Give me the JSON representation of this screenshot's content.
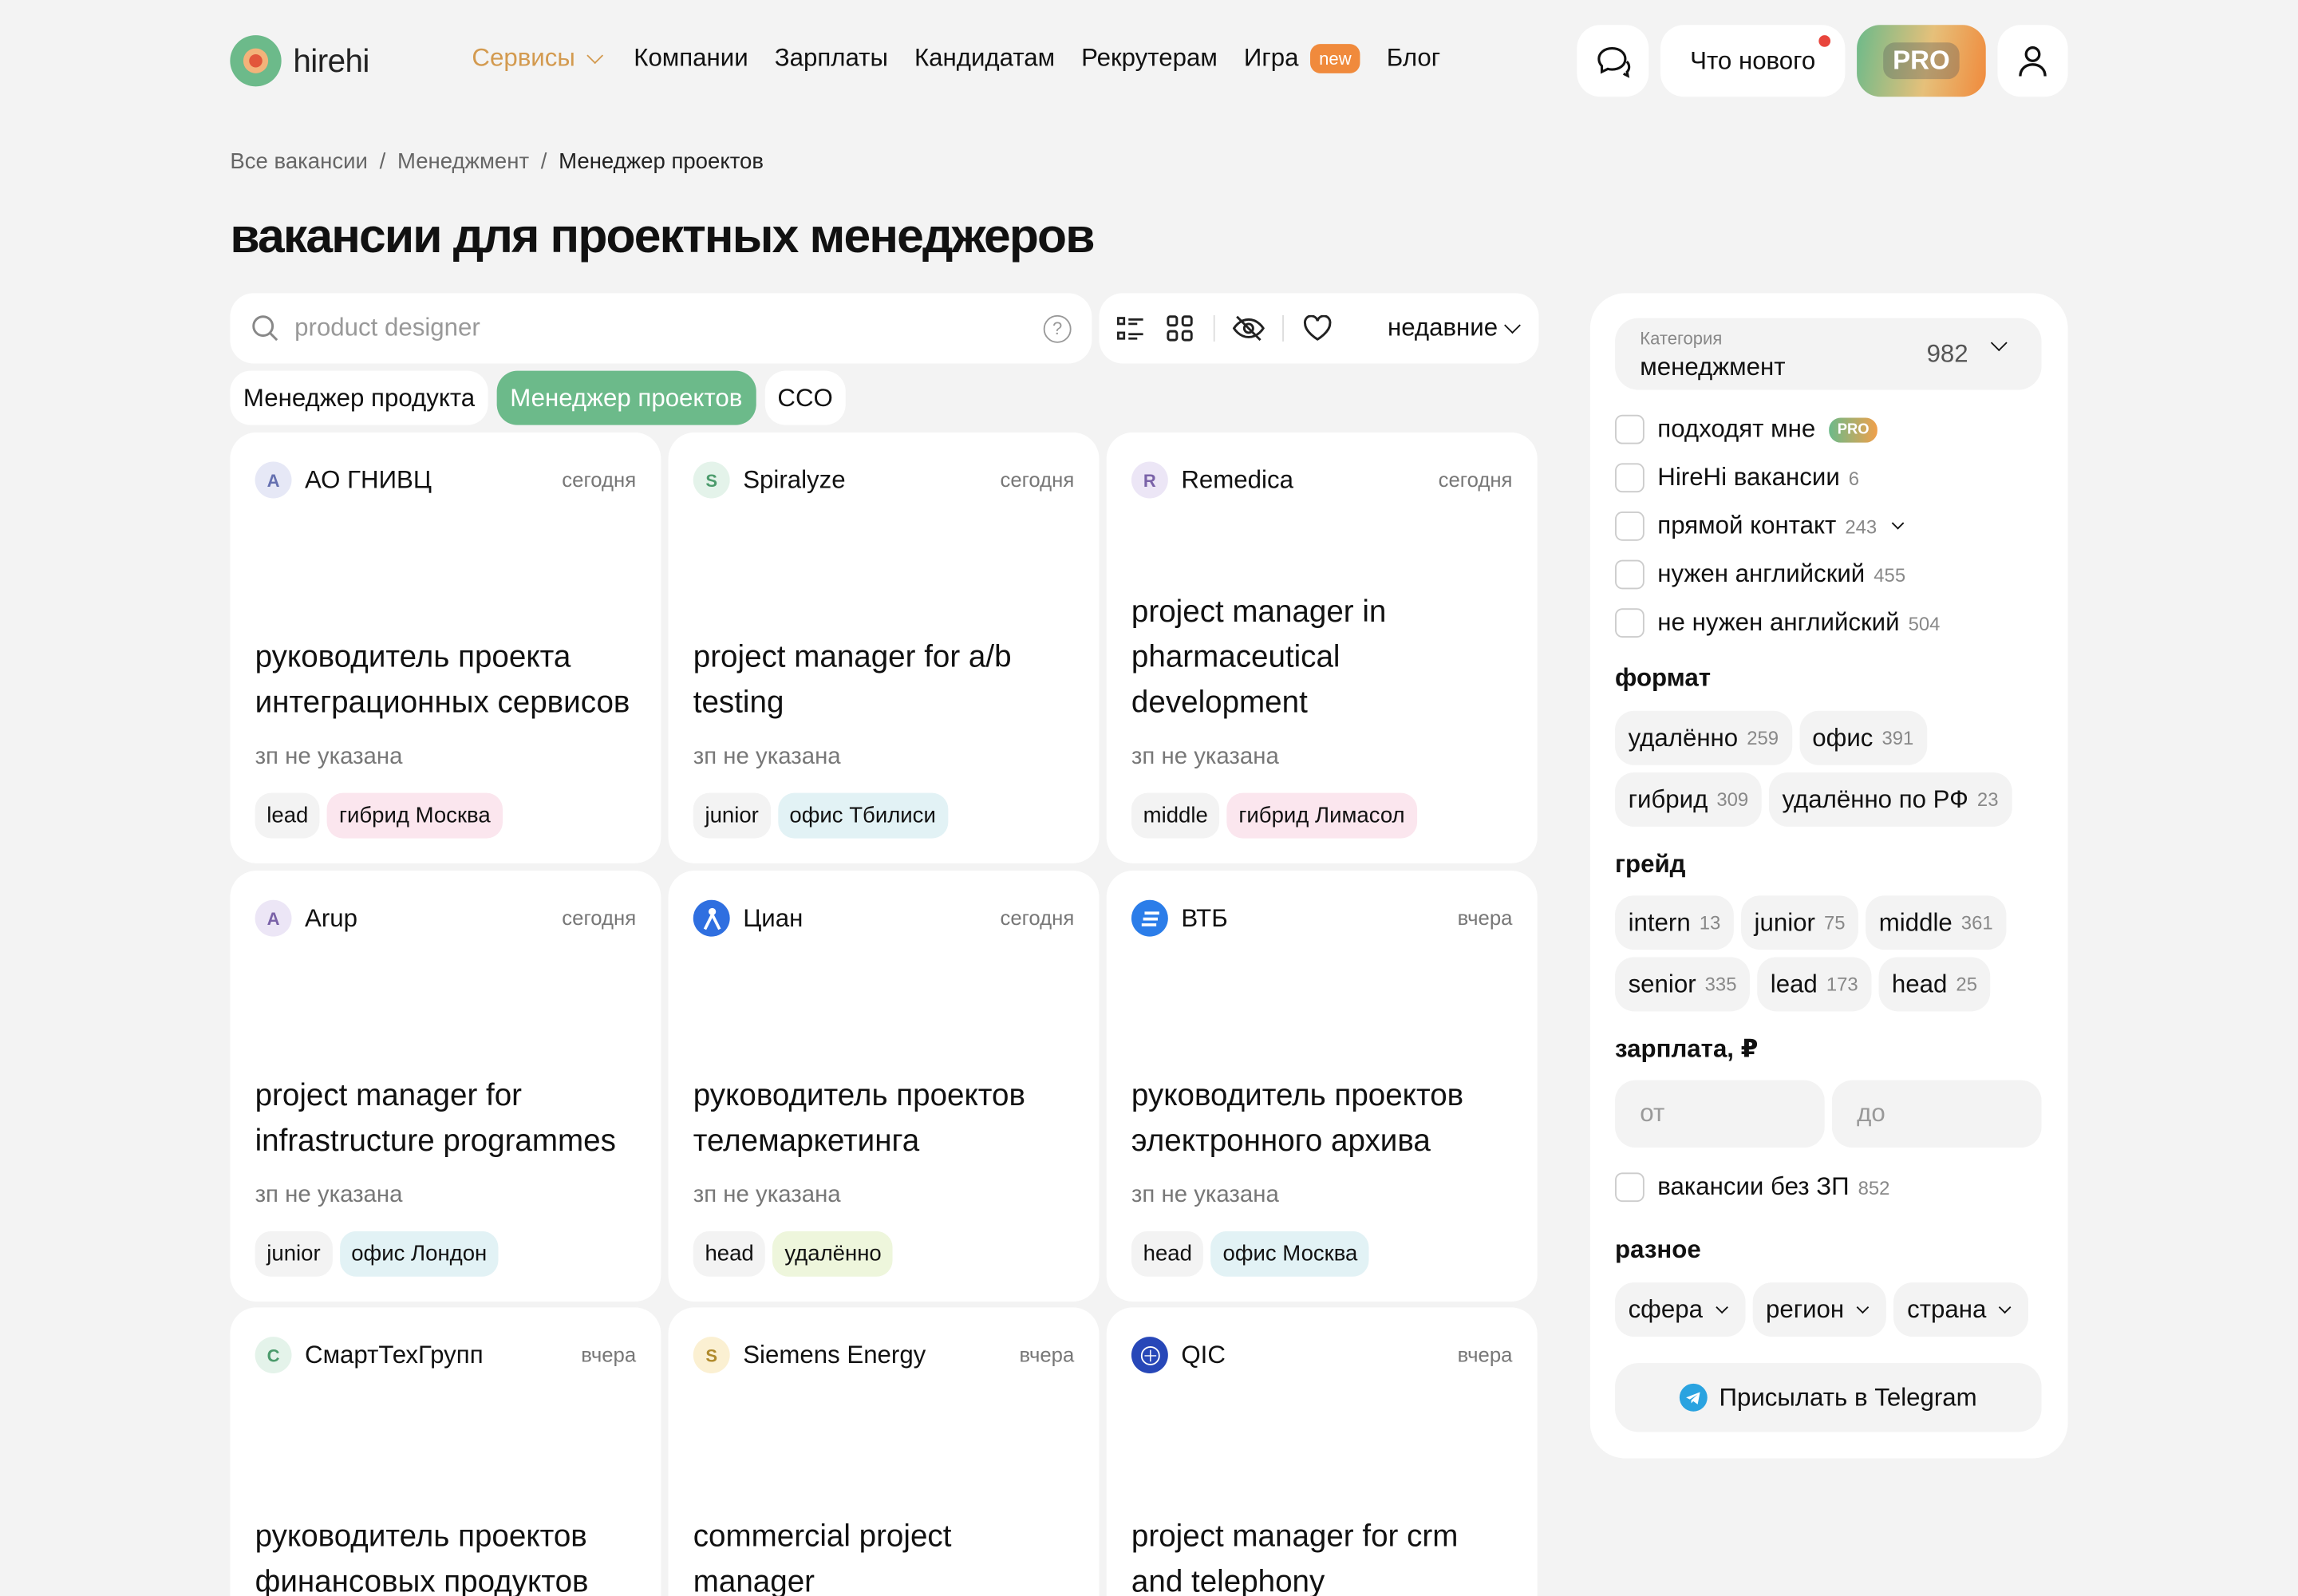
{
  "header": {
    "logo": "hirehi",
    "nav": {
      "services": "Сервисы",
      "companies": "Компании",
      "salaries": "Зарплаты",
      "candidates": "Кандидатам",
      "recruiters": "Рекрутерам",
      "game": "Игра",
      "game_badge": "new",
      "blog": "Блог"
    },
    "whats_new": "Что нового",
    "pro": "PRO"
  },
  "breadcrumb": [
    "Все вакансии",
    "/",
    "Менеджмент",
    "/",
    "Менеджер проектов"
  ],
  "page_title": "вакансии для проектных менеджеров",
  "search": {
    "placeholder": "product designer",
    "help": "?"
  },
  "sort": "недавние",
  "chips": [
    "Менеджер продукта",
    "Менеджер проектов",
    "CCO"
  ],
  "cards": [
    {
      "company": "АО ГНИВЦ",
      "initial": "A",
      "date": "сегодня",
      "title": "руководитель проекта интеграционных сервисов",
      "salary": "зп не указана",
      "tags": [
        "lead",
        "гибрид Москва"
      ]
    },
    {
      "company": "Spiralyze",
      "initial": "S",
      "date": "сегодня",
      "title": "project manager for a/b testing",
      "salary": "зп не указана",
      "tags": [
        "junior",
        "офис Тбилиси"
      ]
    },
    {
      "company": "Remedica",
      "initial": "R",
      "date": "сегодня",
      "title": "project manager in pharmaceutical development",
      "salary": "зп не указана",
      "tags": [
        "middle",
        "гибрид Лимасол"
      ]
    },
    {
      "company": "Arup",
      "initial": "A",
      "date": "сегодня",
      "title": "project manager for infrastructure programmes",
      "salary": "зп не указана",
      "tags": [
        "junior",
        "офис Лондон"
      ]
    },
    {
      "company": "Циан",
      "initial": "",
      "date": "сегодня",
      "title": "руководитель проектов телемаркетинга",
      "salary": "зп не указана",
      "tags": [
        "head",
        "удалённо"
      ]
    },
    {
      "company": "ВТБ",
      "initial": "",
      "date": "вчера",
      "title": "руководитель проектов электронного архива",
      "salary": "зп не указана",
      "tags": [
        "head",
        "офис Москва"
      ]
    },
    {
      "company": "СмартТехГрупп",
      "initial": "C",
      "date": "вчера",
      "title": "руководитель проектов финансовых продуктов",
      "salary": "",
      "tags": []
    },
    {
      "company": "Siemens Energy",
      "initial": "S",
      "date": "вчера",
      "title": "commercial project manager",
      "salary": "",
      "tags": []
    },
    {
      "company": "QIC",
      "initial": "",
      "date": "вчера",
      "title": "project manager for crm and telephony",
      "salary": "",
      "tags": []
    }
  ],
  "filters": {
    "category_label": "Категория",
    "category_value": "менеджмент",
    "category_count": "982",
    "checks": [
      {
        "label": "подходят мне",
        "count": "",
        "badge": "PRO"
      },
      {
        "label": "HireHi вакансии",
        "count": "6"
      },
      {
        "label": "прямой контакт",
        "count": "243"
      },
      {
        "label": "нужен английский",
        "count": "455"
      },
      {
        "label": "не нужен английский",
        "count": "504"
      }
    ],
    "format_title": "формат",
    "format": [
      {
        "label": "удалённо",
        "count": "259"
      },
      {
        "label": "офис",
        "count": "391"
      },
      {
        "label": "гибрид",
        "count": "309"
      },
      {
        "label": "удалённо по РФ",
        "count": "23"
      }
    ],
    "grade_title": "грейд",
    "grade": [
      {
        "label": "intern",
        "count": "13"
      },
      {
        "label": "junior",
        "count": "75"
      },
      {
        "label": "middle",
        "count": "361"
      },
      {
        "label": "senior",
        "count": "335"
      },
      {
        "label": "lead",
        "count": "173"
      },
      {
        "label": "head",
        "count": "25"
      }
    ],
    "salary_title": "зарплата, ₽",
    "salary_from": "от",
    "salary_to": "до",
    "no_salary": {
      "label": "вакансии без ЗП",
      "count": "852"
    },
    "misc_title": "разное",
    "misc": [
      "сфера",
      "регион",
      "страна"
    ],
    "telegram": "Присылать в Telegram"
  },
  "colors": {
    "accent": "#6cba8a",
    "orange": "#f08a3c",
    "services": "#d39a4f"
  }
}
